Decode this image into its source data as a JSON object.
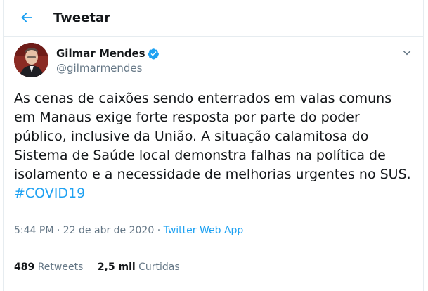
{
  "header": {
    "title": "Tweetar"
  },
  "author": {
    "name": "Gilmar Mendes",
    "handle": "@gilmarmendes"
  },
  "tweet": {
    "text": "As cenas de caixões sendo enterrados em valas comuns em Manaus exige forte resposta por parte do poder público, inclusive da União. A situação calamitosa do Sistema de Saúde local demonstra falhas na política de isolamento e a necessidade de melhorias urgentes no SUS.",
    "hashtag": "#COVID19",
    "time": "5:44 PM",
    "separator": "·",
    "date": "22 de abr de 2020",
    "app": "Twitter Web App"
  },
  "stats": {
    "retweets_count": "489",
    "retweets_label": "Retweets",
    "likes_count": "2,5 mil",
    "likes_label": "Curtidas"
  },
  "colors": {
    "accent": "#1da1f2",
    "secondary_text": "#657786",
    "border": "#e6ecf0"
  },
  "icons": {
    "back": "arrow-left-icon",
    "verified": "verified-badge-icon",
    "caret": "chevron-down-icon"
  }
}
